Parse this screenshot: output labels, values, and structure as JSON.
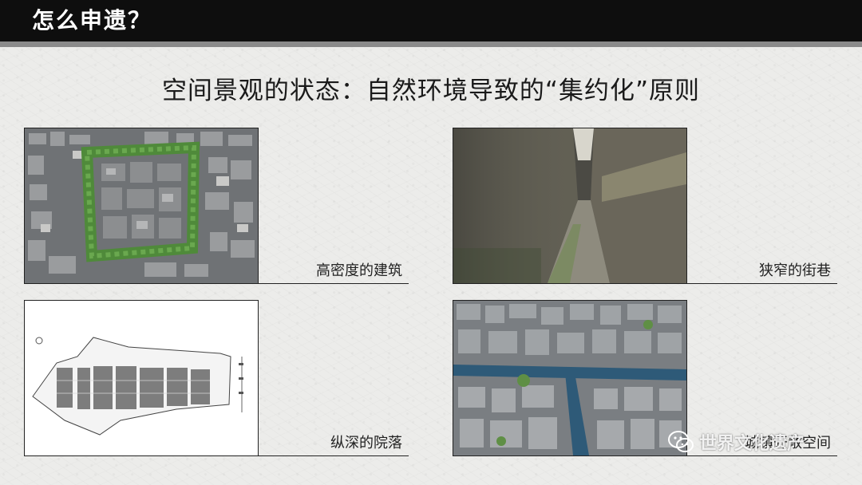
{
  "header": {
    "title": "怎么申遗？"
  },
  "slide": {
    "title": "空间景观的状态：自然环境导致的“集约化”原则"
  },
  "panels": [
    {
      "caption": "高密度的建筑"
    },
    {
      "caption": "狭窄的街巷"
    },
    {
      "caption": "纵深的院落"
    },
    {
      "caption": "城镇开敞空间"
    }
  ],
  "watermark": {
    "text": "世界文化遗产",
    "icon": "wechat-icon"
  },
  "colors": {
    "header_bg": "#0e0e0e",
    "header_strip": "#8a8a8a",
    "text": "#1a1a1a"
  }
}
